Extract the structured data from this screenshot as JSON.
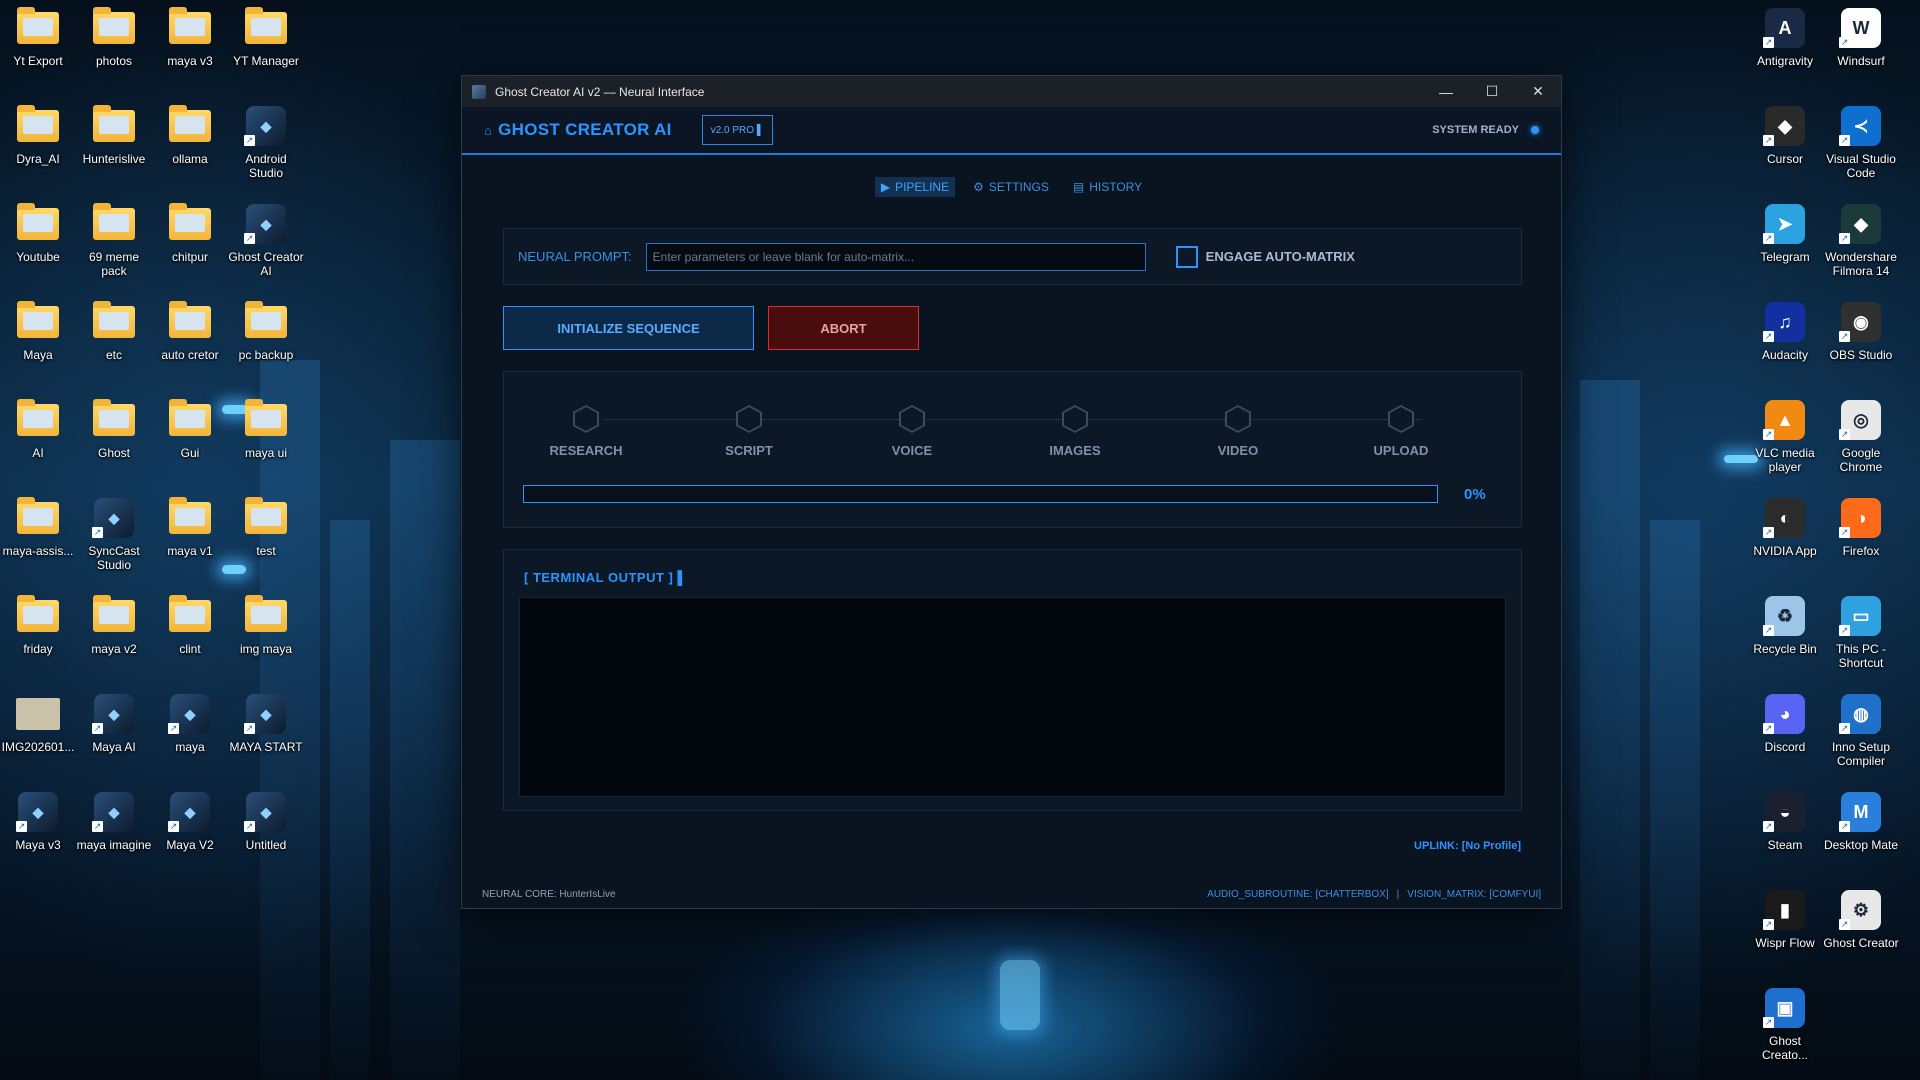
{
  "desktop": {
    "left_icons": [
      {
        "label": "Yt Export",
        "kind": "folder"
      },
      {
        "label": "photos",
        "kind": "folder"
      },
      {
        "label": "maya v3",
        "kind": "folder"
      },
      {
        "label": "YT Manager",
        "kind": "folder"
      },
      {
        "label": "Dyra_AI",
        "kind": "folder"
      },
      {
        "label": "Hunterislive",
        "kind": "folder"
      },
      {
        "label": "ollama",
        "kind": "folder"
      },
      {
        "label": "Android Studio",
        "kind": "app"
      },
      {
        "label": "Youtube",
        "kind": "folder"
      },
      {
        "label": "69 meme pack",
        "kind": "folder"
      },
      {
        "label": "chitpur",
        "kind": "folder"
      },
      {
        "label": "Ghost Creator AI",
        "kind": "app"
      },
      {
        "label": "Maya",
        "kind": "folder"
      },
      {
        "label": "etc",
        "kind": "folder"
      },
      {
        "label": "auto cretor",
        "kind": "folder"
      },
      {
        "label": "pc backup",
        "kind": "folder"
      },
      {
        "label": "AI",
        "kind": "folder"
      },
      {
        "label": "Ghost",
        "kind": "folder"
      },
      {
        "label": "Gui",
        "kind": "folder"
      },
      {
        "label": "maya ui",
        "kind": "folder"
      },
      {
        "label": "maya-assis...",
        "kind": "folder"
      },
      {
        "label": "SyncCast Studio",
        "kind": "app"
      },
      {
        "label": "maya v1",
        "kind": "folder"
      },
      {
        "label": "test",
        "kind": "folder"
      },
      {
        "label": "friday",
        "kind": "folder"
      },
      {
        "label": "maya v2",
        "kind": "folder"
      },
      {
        "label": "clint",
        "kind": "folder"
      },
      {
        "label": "img maya",
        "kind": "folder"
      },
      {
        "label": "IMG202601...",
        "kind": "image"
      },
      {
        "label": "Maya AI",
        "kind": "app"
      },
      {
        "label": "maya",
        "kind": "app"
      },
      {
        "label": "MAYA START",
        "kind": "app"
      },
      {
        "label": "Maya v3",
        "kind": "app"
      },
      {
        "label": "maya imagine",
        "kind": "app"
      },
      {
        "label": "Maya V2",
        "kind": "app"
      },
      {
        "label": "Untitled",
        "kind": "app"
      }
    ],
    "right_icons": [
      {
        "label": "Antigravity",
        "color": "#1a2a44",
        "glyph": "A"
      },
      {
        "label": "Windsurf",
        "color": "#ffffff",
        "glyph": "W"
      },
      {
        "label": "Cursor",
        "color": "#2a2a2a",
        "glyph": "◆"
      },
      {
        "label": "Visual Studio Code",
        "color": "#0e6fd0",
        "glyph": "≺"
      },
      {
        "label": "Telegram",
        "color": "#2aa3e0",
        "glyph": "➤"
      },
      {
        "label": "Wondershare Filmora 14",
        "color": "#1b3b3a",
        "glyph": "◆"
      },
      {
        "label": "Audacity",
        "color": "#1230a0",
        "glyph": "♫"
      },
      {
        "label": "OBS Studio",
        "color": "#303030",
        "glyph": "◉"
      },
      {
        "label": "VLC media player",
        "color": "#f08a12",
        "glyph": "▲"
      },
      {
        "label": "Google Chrome",
        "color": "#e8e8e8",
        "glyph": "◎"
      },
      {
        "label": "NVIDIA App",
        "color": "#2b2b2b",
        "glyph": "◐"
      },
      {
        "label": "Firefox",
        "color": "#ff6a1a",
        "glyph": "◑"
      },
      {
        "label": "Recycle Bin",
        "color": "#9cc6e8",
        "glyph": "♻"
      },
      {
        "label": "This PC - Shortcut",
        "color": "#2fa0e0",
        "glyph": "▭"
      },
      {
        "label": "Discord",
        "color": "#5865f2",
        "glyph": "◕"
      },
      {
        "label": "Inno Setup Compiler",
        "color": "#1f70c8",
        "glyph": "◍"
      },
      {
        "label": "Steam",
        "color": "#1a2030",
        "glyph": "◒"
      },
      {
        "label": "Desktop Mate",
        "color": "#2b7fdc",
        "glyph": "M"
      },
      {
        "label": "Wispr Flow",
        "color": "#1a1a1a",
        "glyph": "▮"
      },
      {
        "label": "Ghost Creator",
        "color": "#e8e8e8",
        "glyph": "⚙"
      },
      {
        "label": "Ghost Creato...",
        "color": "#1f6fd0",
        "glyph": "▣"
      }
    ]
  },
  "window": {
    "title": "Ghost Creator AI v2 — Neural Interface",
    "controls": {
      "minimize": "—",
      "maximize": "☐",
      "close": "✕"
    }
  },
  "header": {
    "brand": "GHOST CREATOR AI",
    "version": "v2.0 PRO ▌",
    "status": "SYSTEM READY"
  },
  "tabs": [
    {
      "icon": "▶",
      "label": "PIPELINE",
      "active": true
    },
    {
      "icon": "⚙",
      "label": "SETTINGS",
      "active": false
    },
    {
      "icon": "▤",
      "label": "HISTORY",
      "active": false
    }
  ],
  "prompt": {
    "label": "NEURAL PROMPT:",
    "value": "",
    "placeholder": "Enter parameters or leave blank for auto-matrix...",
    "checkbox_label": "ENGAGE AUTO-MATRIX",
    "checked": false
  },
  "actions": {
    "initialize": "INITIALIZE SEQUENCE",
    "abort": "ABORT"
  },
  "pipeline": {
    "steps": [
      "RESEARCH",
      "SCRIPT",
      "VOICE",
      "IMAGES",
      "VIDEO",
      "UPLOAD"
    ],
    "progress": 0,
    "progress_label": "0%"
  },
  "terminal": {
    "title": "[ TERMINAL OUTPUT ] ▌",
    "lines": []
  },
  "status": {
    "uplink": "UPLINK: [No Profile]",
    "neural_core": "NEURAL CORE: HunterIsLive",
    "audio": "AUDIO_SUBROUTINE: [CHATTERBOX]",
    "separator": "|",
    "vision": "VISION_MATRIX: [COMFYUI]"
  },
  "colors": {
    "accent": "#2b95ff",
    "abort": "#d03030",
    "window_bg": "#0a1320"
  }
}
